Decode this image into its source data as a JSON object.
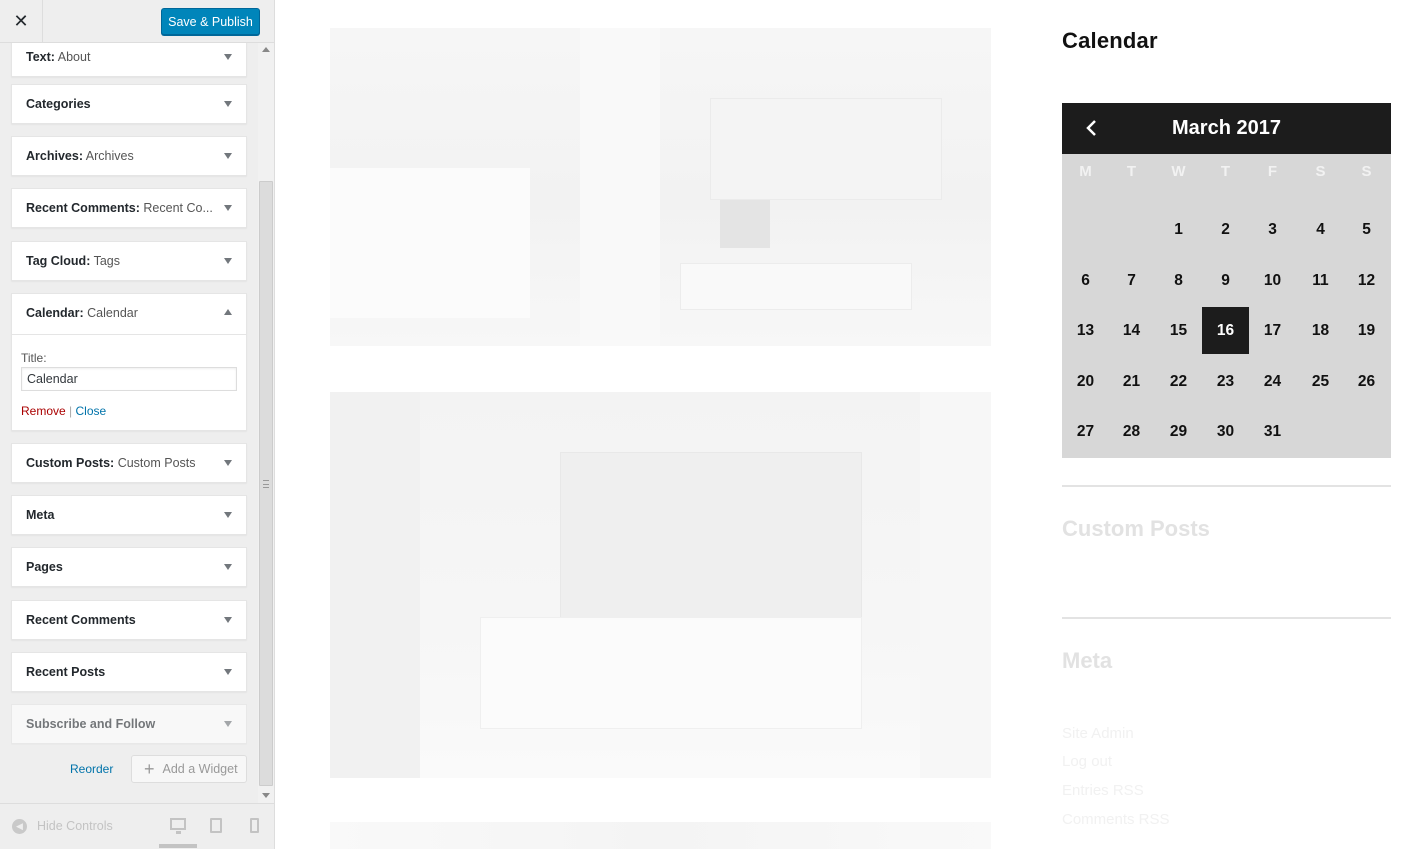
{
  "topbar": {
    "close_glyph": "✕",
    "publish_label": "Save & Publish"
  },
  "widgets": [
    {
      "title": "Text",
      "sub": "About"
    },
    {
      "title": "Categories",
      "sub": ""
    },
    {
      "title": "Archives",
      "sub": "Archives"
    },
    {
      "title": "Recent Comments",
      "sub": "Recent Co..."
    },
    {
      "title": "Tag Cloud",
      "sub": "Tags"
    },
    {
      "title": "Calendar",
      "sub": "Calendar"
    },
    {
      "title": "Custom Posts",
      "sub": "Custom Posts"
    },
    {
      "title": "Meta",
      "sub": ""
    },
    {
      "title": "Pages",
      "sub": ""
    },
    {
      "title": "Recent Comments",
      "sub": ""
    },
    {
      "title": "Recent Posts",
      "sub": ""
    },
    {
      "title": "Subscribe and Follow",
      "sub": ""
    }
  ],
  "calendar_form": {
    "title_label": "Title:",
    "title_value": "Calendar",
    "remove_label": "Remove",
    "separator": "|",
    "close_label": "Close"
  },
  "actions": {
    "reorder_label": "Reorder",
    "add_widget_label": "Add a Widget"
  },
  "footer": {
    "hide_controls_label": "Hide Controls"
  },
  "preview": {
    "sidebar_title": "Calendar",
    "calendar": {
      "month_label": "March 2017",
      "weekdays": [
        "M",
        "T",
        "W",
        "T",
        "F",
        "S",
        "S"
      ],
      "first_weekday_index": 2,
      "days_in_month": 31,
      "today": 16
    },
    "custom_posts_heading": "Custom Posts",
    "meta_heading": "Meta",
    "meta_links": [
      "Site Admin",
      "Log out",
      "Entries RSS",
      "Comments RSS"
    ]
  },
  "colors": {
    "accent": "#0085ba",
    "calendar_header": "#1c1c1c",
    "calendar_body": "#d7d7d7",
    "link": "#0073aa",
    "remove": "#a00"
  }
}
